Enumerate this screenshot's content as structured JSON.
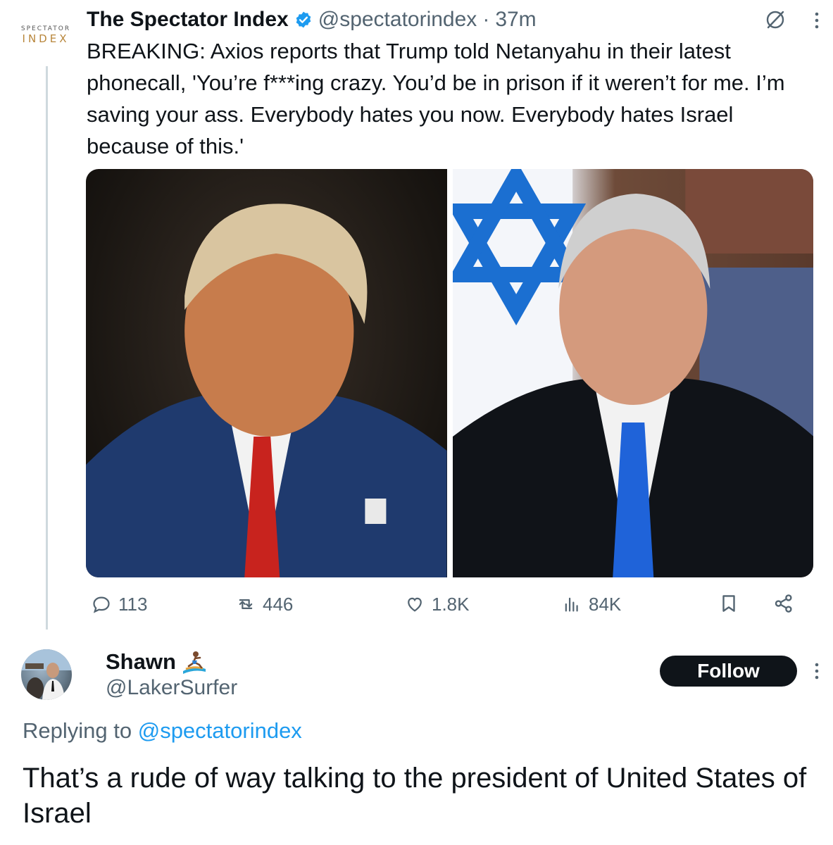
{
  "tweet": {
    "author_name": "The Spectator Index",
    "handle": "@spectatorindex",
    "separator": "·",
    "time": "37m",
    "avatar_logo": {
      "line1": "SPECTATOR",
      "line2": "INDEX"
    },
    "text": "BREAKING: Axios reports that Trump told Netanyahu in their latest phonecall, 'You’re f***ing crazy. You’d be in prison if it weren’t for me. I’m saving your ass. Everybody hates you now. Everybody hates Israel because of this.'",
    "icons": [
      "verified-badge-icon",
      "grok-icon",
      "more-options-icon"
    ],
    "images": [
      {
        "name": "photo-trump"
      },
      {
        "name": "photo-netanyahu"
      }
    ],
    "stats": {
      "replies": "113",
      "reposts": "446",
      "likes": "1.8K",
      "views": "84K"
    },
    "action_icons": [
      "reply-icon",
      "repost-icon",
      "like-icon",
      "views-icon",
      "bookmark-icon",
      "share-icon"
    ]
  },
  "reply": {
    "author_name": "Shawn",
    "name_emoji": "surfer-icon",
    "handle": "@LakerSurfer",
    "follow_label": "Follow",
    "replying_prefix": "Replying to",
    "replying_mention": "@spectatorindex",
    "text": "That’s a rude of way talking to the president of United States of Israel"
  },
  "colors": {
    "text": "#0f1419",
    "secondary": "#536471",
    "link": "#1d9bf0",
    "verified": "#1d9bf0",
    "button": "#0f1419",
    "thread_line": "#cfd9de"
  }
}
